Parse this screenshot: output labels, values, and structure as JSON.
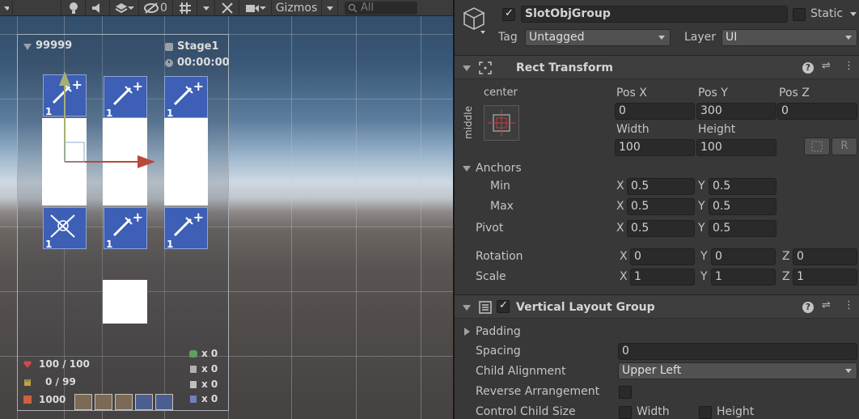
{
  "scene": {
    "toolbar": {
      "gizmos_label": "Gizmos",
      "hidden_count": "0",
      "search_placeholder": "All"
    },
    "hud": {
      "currency": "99999",
      "stage": "Stage1",
      "timer": "00:00:00",
      "hp": "100 / 100",
      "capacity": "0 / 99",
      "gold": "1000",
      "counters": [
        "x 0",
        "x 0",
        "x 0",
        "x 0"
      ],
      "slot_count": "1"
    }
  },
  "inspector": {
    "object": {
      "active": true,
      "name": "SlotObjGroup",
      "static_label": "Static",
      "tag_label": "Tag",
      "tag_value": "Untagged",
      "layer_label": "Layer",
      "layer_value": "UI"
    },
    "rect_transform": {
      "title": "Rect Transform",
      "anchor_h": "center",
      "anchor_v": "middle",
      "pos_x_label": "Pos X",
      "pos_x": "0",
      "pos_y_label": "Pos Y",
      "pos_y": "300",
      "pos_z_label": "Pos Z",
      "pos_z": "0",
      "width_label": "Width",
      "width": "100",
      "height_label": "Height",
      "height": "100",
      "r_button": "R",
      "anchors_label": "Anchors",
      "min_label": "Min",
      "min_x": "0.5",
      "min_y": "0.5",
      "max_label": "Max",
      "max_x": "0.5",
      "max_y": "0.5",
      "pivot_label": "Pivot",
      "pivot_x": "0.5",
      "pivot_y": "0.5",
      "rotation_label": "Rotation",
      "rot_x": "0",
      "rot_y": "0",
      "rot_z": "0",
      "scale_label": "Scale",
      "scale_x": "1",
      "scale_y": "1",
      "scale_z": "1",
      "axis_x": "X",
      "axis_y": "Y",
      "axis_z": "Z"
    },
    "vertical_layout": {
      "title": "Vertical Layout Group",
      "enabled": true,
      "padding_label": "Padding",
      "spacing_label": "Spacing",
      "spacing": "0",
      "child_alignment_label": "Child Alignment",
      "child_alignment": "Upper Left",
      "reverse_label": "Reverse Arrangement",
      "control_size_label": "Control Child Size",
      "width_label": "Width",
      "height_label": "Height"
    }
  },
  "colors": {
    "slot_blue": "#3d5fb5",
    "inspector_bg": "#383838",
    "field_bg": "#2a2a2a"
  }
}
